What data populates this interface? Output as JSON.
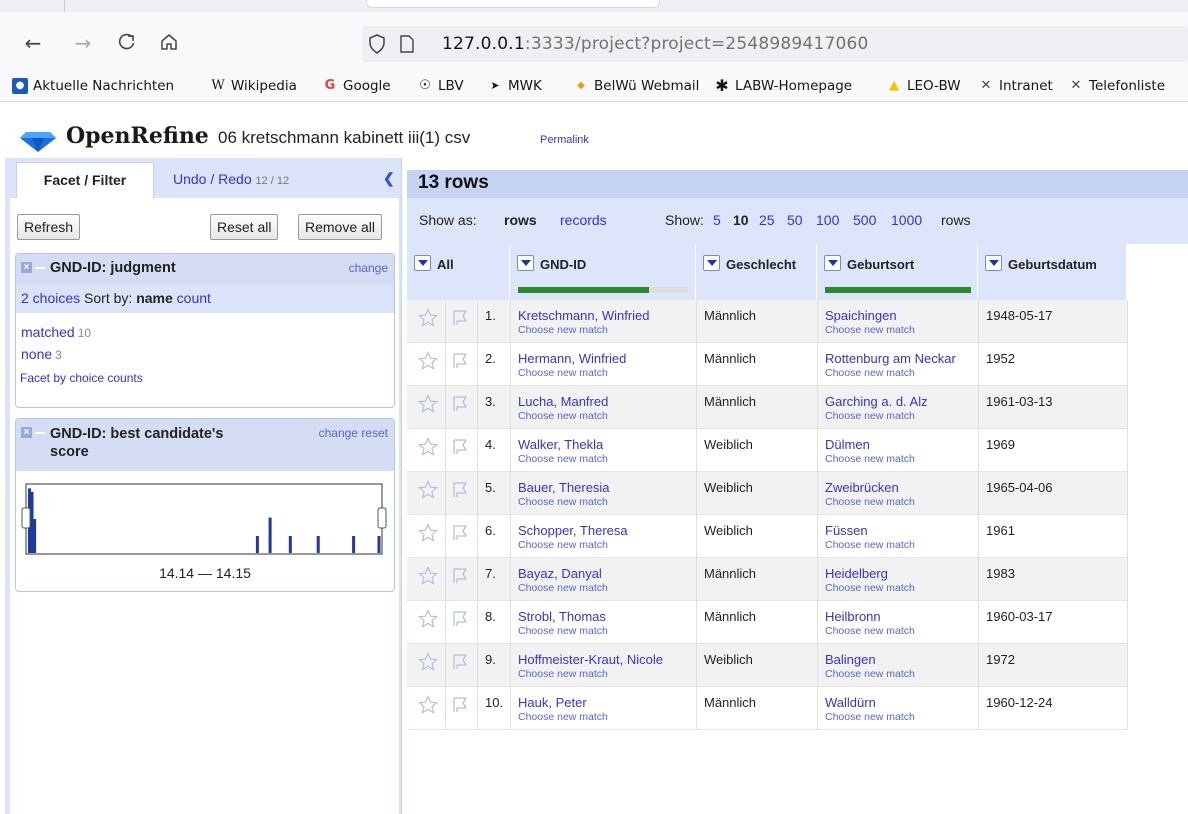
{
  "browser": {
    "url_host": "127.0.0.1",
    "url_rest": ":3333/project?project=2548989417060",
    "nav_icons": [
      "back-arrow-icon",
      "forward-arrow-icon",
      "reload-icon",
      "home-icon"
    ],
    "bookmarks": [
      {
        "label": "Aktuelle Nachrichten",
        "icon": "news-icon"
      },
      {
        "label": "Wikipedia",
        "icon": "wikipedia-icon"
      },
      {
        "label": "Google",
        "icon": "google-icon"
      },
      {
        "label": "LBV",
        "icon": "globe-icon"
      },
      {
        "label": "MWK",
        "icon": "mwk-icon"
      },
      {
        "label": "BelWü Webmail",
        "icon": "belwue-icon"
      },
      {
        "label": "LABW-Homepage",
        "icon": "labw-icon"
      },
      {
        "label": "LEO-BW",
        "icon": "leo-icon"
      },
      {
        "label": "Intranet",
        "icon": "intranet-icon"
      },
      {
        "label": "Telefonliste",
        "icon": "intranet-icon"
      }
    ]
  },
  "app": {
    "brand": "OpenRefine",
    "project_name": "06 kretschmann kabinett iii(1) csv",
    "permalink": "Permalink"
  },
  "left": {
    "tab_facet": "Facet / Filter",
    "tab_undo": "Undo / Redo",
    "tab_undo_count": "12 / 12",
    "refresh": "Refresh",
    "reset_all": "Reset all",
    "remove_all": "Remove all",
    "facet1": {
      "title": "GND-ID: judgment",
      "change": "change",
      "choices_label": "2 choices",
      "sort_by": "Sort by:",
      "sort_name": "name",
      "sort_count": "count",
      "items": [
        {
          "label": "matched",
          "count": "10"
        },
        {
          "label": "none",
          "count": "3"
        }
      ],
      "facet_by_counts": "Facet by choice counts"
    },
    "facet2": {
      "title_line1": "GND-ID: best candidate's",
      "title_line2": "score",
      "change": "change",
      "reset": "reset",
      "range_label": "14.14 — 14.15",
      "histogram": [
        0.95,
        0.9,
        0.5,
        0,
        0,
        0,
        0,
        0,
        0,
        0,
        0,
        0,
        0,
        0,
        0,
        0,
        0,
        0,
        0,
        0,
        0,
        0,
        0,
        0,
        0,
        0,
        0,
        0,
        0,
        0,
        0,
        0,
        0,
        0,
        0,
        0,
        0,
        0,
        0,
        0,
        0,
        0,
        0,
        0,
        0,
        0,
        0,
        0,
        0,
        0,
        0,
        0,
        0,
        0,
        0,
        0,
        0,
        0,
        0,
        0,
        0,
        0,
        0,
        0,
        0,
        0,
        0,
        0,
        0,
        0,
        0,
        0,
        0,
        0,
        0,
        0,
        0,
        0,
        0,
        0,
        0,
        0,
        0,
        0,
        0,
        0,
        0,
        0,
        0,
        0,
        0.25,
        0,
        0,
        0,
        0,
        0.52,
        0,
        0,
        0,
        0,
        0,
        0,
        0,
        0.25,
        0,
        0,
        0,
        0,
        0,
        0,
        0,
        0,
        0,
        0,
        0.25,
        0,
        0,
        0,
        0,
        0,
        0,
        0,
        0,
        0,
        0,
        0,
        0,
        0,
        0.25,
        0,
        0,
        0,
        0,
        0,
        0,
        0,
        0,
        0,
        0.25
      ],
      "bar_color": "#1f3a9c"
    }
  },
  "main": {
    "rows_title": "13 rows",
    "show_as": "Show as:",
    "rows_mode": "rows",
    "records_mode": "records",
    "show": "Show:",
    "page_sizes": [
      "5",
      "10",
      "25",
      "50",
      "100",
      "500",
      "1000"
    ],
    "page_size_selected": "10",
    "rows_suffix": "rows",
    "columns": [
      {
        "label": "All",
        "completeness": null
      },
      {
        "label": "GND-ID",
        "completeness": 0.77
      },
      {
        "label": "Geschlecht",
        "completeness": null
      },
      {
        "label": "Geburtsort",
        "completeness": 1.0
      },
      {
        "label": "Geburtsdatum",
        "completeness": null
      }
    ],
    "choose_new_match": "Choose new match",
    "rows": [
      {
        "n": "1.",
        "gnd": "Kretschmann, Winfried",
        "sex": "Männlich",
        "ort": "Spaichingen",
        "datum": "1948-05-17"
      },
      {
        "n": "2.",
        "gnd": "Hermann, Winfried",
        "sex": "Männlich",
        "ort": "Rottenburg am Neckar",
        "datum": "1952"
      },
      {
        "n": "3.",
        "gnd": "Lucha, Manfred",
        "sex": "Männlich",
        "ort": "Garching a. d. Alz",
        "datum": "1961-03-13"
      },
      {
        "n": "4.",
        "gnd": "Walker, Thekla",
        "sex": "Weiblich",
        "ort": "Dülmen",
        "datum": "1969"
      },
      {
        "n": "5.",
        "gnd": "Bauer, Theresia",
        "sex": "Weiblich",
        "ort": "Zweibrücken",
        "datum": "1965-04-06"
      },
      {
        "n": "6.",
        "gnd": "Schopper, Theresa",
        "sex": "Weiblich",
        "ort": "Füssen",
        "datum": "1961"
      },
      {
        "n": "7.",
        "gnd": "Bayaz, Danyal",
        "sex": "Männlich",
        "ort": "Heidelberg",
        "datum": "1983"
      },
      {
        "n": "8.",
        "gnd": "Strobl, Thomas",
        "sex": "Männlich",
        "ort": "Heilbronn",
        "datum": "1960-03-17"
      },
      {
        "n": "9.",
        "gnd": "Hoffmeister-Kraut, Nicole",
        "sex": "Weiblich",
        "ort": "Balingen",
        "datum": "1972"
      },
      {
        "n": "10.",
        "gnd": "Hauk, Peter",
        "sex": "Männlich",
        "ort": "Walldürn",
        "datum": "1960-12-24"
      }
    ]
  }
}
